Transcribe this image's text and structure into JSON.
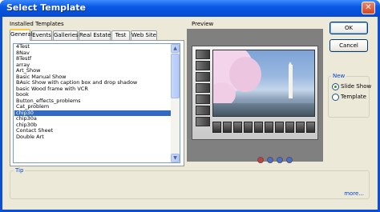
{
  "window": {
    "title": "Select Template"
  },
  "installed_label": "Installed Templates",
  "tabs": [
    "General",
    "Events",
    "Galleries",
    "Real Estate",
    "Test",
    "Web Site"
  ],
  "active_tab": "General",
  "templates": [
    "4Test",
    "8Nav",
    "8Testf",
    "array",
    "Art_Show",
    "Basic Manual Show",
    "BAsic Show with caption box and drop shadow",
    "basic Wood frame with VCR",
    "book",
    "Button_effects_problems",
    "Cat_problem",
    "chip30",
    "chip30a",
    "chip30b",
    "Contact Sheet",
    "Double Art"
  ],
  "selected_template": "chip30",
  "preview_label": "Preview",
  "buttons": {
    "ok": "OK",
    "cancel": "Cancel"
  },
  "new_group": {
    "label": "New",
    "options": [
      "Slide Show",
      "Template"
    ],
    "selected": "Slide Show"
  },
  "tip": {
    "label": "Tip",
    "more": "more..."
  },
  "colors": {
    "titlebar": "#0a58e4",
    "selection": "#316ac5",
    "dialog_bg": "#ece9d8",
    "link": "#0046d5"
  },
  "icons": [
    "close-icon",
    "scroll-up-icon",
    "scroll-down-icon"
  ]
}
